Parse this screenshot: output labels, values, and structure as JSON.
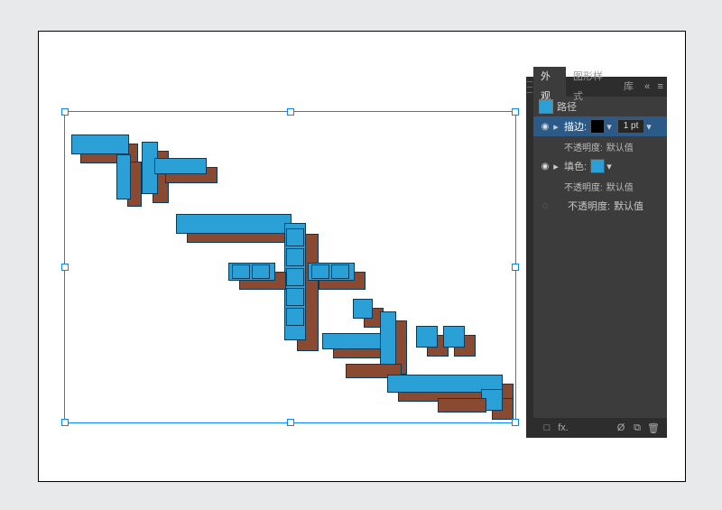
{
  "panel": {
    "tabs": {
      "appearance": "外观",
      "graphic_styles": "图形样式",
      "library": "库"
    },
    "menu_glyph": "»",
    "options_glyph": "≡",
    "target_label": "路径",
    "stroke": {
      "label": "描边:",
      "weight_value": "1 pt",
      "color_hex": "#000000",
      "opacity_label": "不透明度:",
      "opacity_value": "默认值"
    },
    "fill": {
      "label": "填色:",
      "color_hex": "#2aa0d6",
      "opacity_label": "不透明度:",
      "opacity_value": "默认值"
    },
    "object_opacity": {
      "label": "不透明度:",
      "value": "默认值"
    },
    "footer": {
      "new_art_basic": "□",
      "fx": "fx.",
      "clear": "Ø",
      "duplicate": "⧉",
      "trash": "🗑"
    },
    "eye_glyph": "◉",
    "link_glyph": "◌",
    "chevron": "▾",
    "panel_collapse": "«"
  },
  "artwork": {
    "fill_hex": "#2aa0d6",
    "stroke_hex": "#063b5c",
    "extrude_hex": "#8a4a32",
    "selection_hex": "#0a84ff"
  }
}
